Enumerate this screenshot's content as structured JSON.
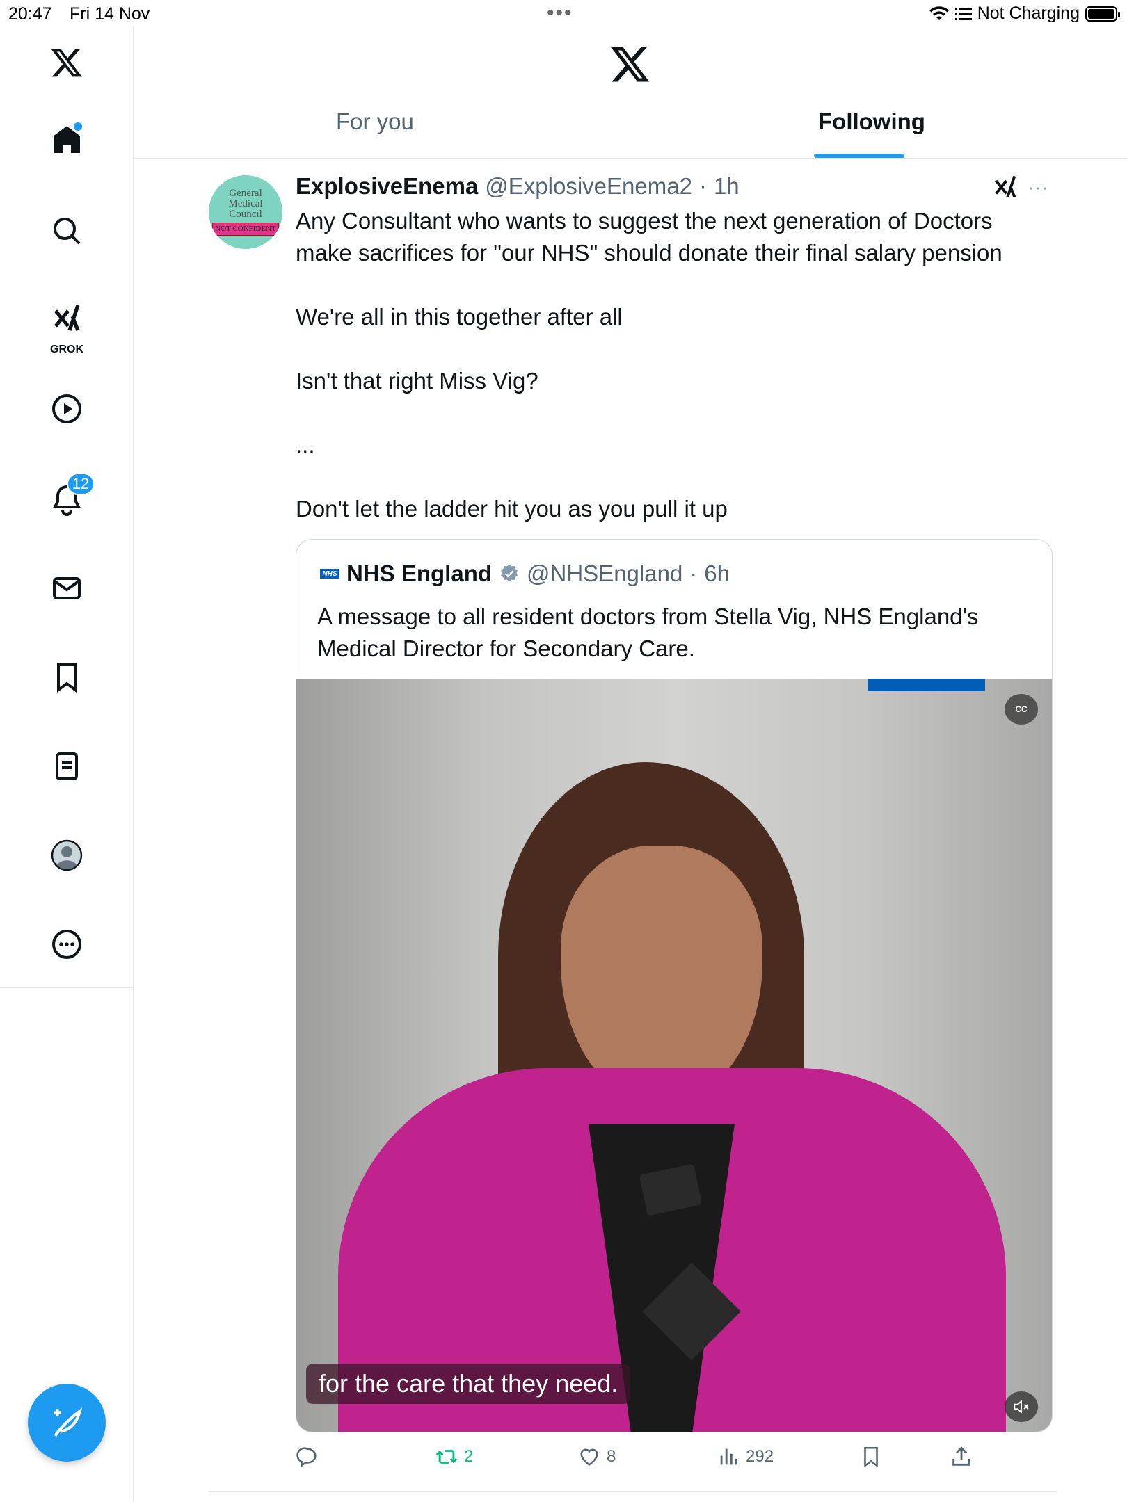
{
  "status_bar": {
    "time": "20:47",
    "date": "Fri 14 Nov",
    "charging": "Not Charging"
  },
  "sidebar": {
    "notifications_badge": "12",
    "grok_label": "GROK"
  },
  "header": {
    "tabs": [
      {
        "label": "For you",
        "active": false
      },
      {
        "label": "Following",
        "active": true
      }
    ]
  },
  "tweet": {
    "avatar_text": [
      "General",
      "Medical",
      "Council",
      "NOT CONFIDENT"
    ],
    "author_name": "ExplosiveEnema",
    "author_handle": "@ExplosiveEnema2",
    "separator": "·",
    "time": "1h",
    "more": "···",
    "body": [
      "Any Consultant who wants to suggest the next generation of Doctors make sacrifices for \"our NHS\" should donate their final salary pension",
      "We're all in this together after all",
      "Isn't that right Miss Vig?",
      "...",
      "Don't let the ladder hit you as you pull it up"
    ],
    "quote": {
      "logo_text": "NHS",
      "author_name": "NHS England",
      "author_handle": "@NHSEngland",
      "separator": "·",
      "time": "6h",
      "text": "A message to all resident doctors from Stella Vig, NHS England's Medical Director for Secondary Care.",
      "video": {
        "cc_label": "CC",
        "subtitle": "for the care that they need."
      }
    },
    "actions": {
      "replies": "",
      "reposts": "2",
      "likes": "8",
      "views": "292"
    }
  },
  "colors": {
    "accent": "#1d9bf0",
    "repost_active": "#00ba7c",
    "text_secondary": "#536471",
    "nhs_blue": "#005eb8"
  }
}
